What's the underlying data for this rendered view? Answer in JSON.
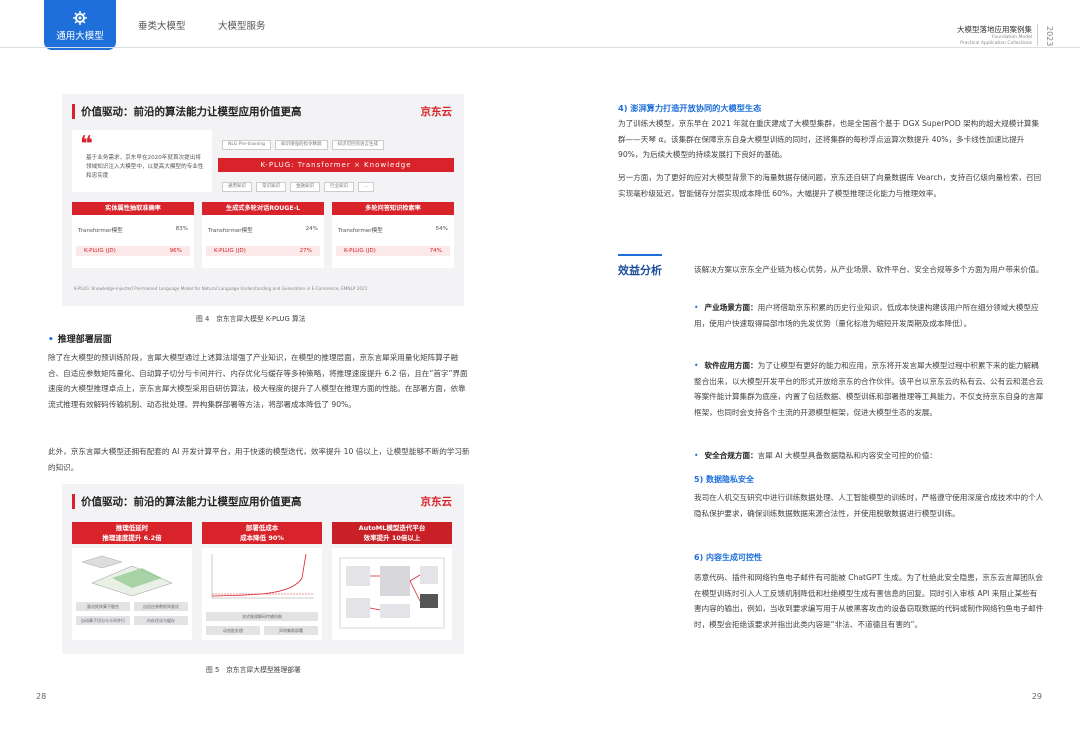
{
  "header": {
    "active_tab": "通用大模型",
    "nav": [
      "垂类大模型",
      "大模型服务"
    ],
    "doc_title": "大模型落地应用案例集",
    "doc_subtitle_1": "Foundation Model",
    "doc_subtitle_2": "Practical Application Collections",
    "year": "2023"
  },
  "figure1": {
    "title": "价值驱动：前沿的算法能力让模型应用价值更高",
    "logo": "京东云",
    "quote": "基于业务需求，京东早在2020年就首次提出将领域知识注入大模型中，以提高大模型的专业性和忠实度",
    "pills_top": [
      "NLG Pre-training",
      "知识增强的指令精调",
      "知识可控的语言生成"
    ],
    "kplug": "K-PLUG: Transformer × Knowledge",
    "pills_bottom": [
      "通用知识",
      "常识知识",
      "金融知识",
      "行业知识",
      "..."
    ],
    "metrics": [
      {
        "title": "实体属性抽取准确率",
        "rows": [
          [
            "Transformer模型",
            "83%"
          ],
          [
            "K-PLUG (JD)",
            "96%"
          ]
        ]
      },
      {
        "title": "生成式多轮对话ROUGE-L",
        "rows": [
          [
            "Transformer模型",
            "24%"
          ],
          [
            "K-PLUG (JD)",
            "27%"
          ]
        ]
      },
      {
        "title": "多轮问答知识检索率",
        "rows": [
          [
            "Transformer模型",
            "54%"
          ],
          [
            "K-PLUG (JD)",
            "74%"
          ]
        ]
      }
    ],
    "footnote": "K-PLUG: Knowledge-injected Pre-trained Language Model for Natural Language Understanding and Generation in E-Commerce, EMNLP 2021",
    "caption": "图 4　京东言犀大模型 K-PLUG 算法"
  },
  "left": {
    "bullet": "推理部署层面",
    "para1": "除了在大模型的预训练阶段，言犀大模型通过上述算法增强了产业知识，在模型的推理层面，京东言犀采用量化矩阵算子融合、自适应参数矩阵量化、自动算子切分与卡间并行、内存优化与缓存等多种策略，将推理速度提升 6.2 倍，且在“首字”界面速度的大模型推理卓点上，京东言犀大模型采用自研仿算法，极大程度的提升了人模型在推理方面的性能。在部署方面，依靠流式推理有效解码传输机制、动态批处理、异构集群部署等方法，将部署成本降低了 90%。",
    "para2": "此外，京东言犀大模型还拥有配套的 AI 开发计算平台，用于快速的模型迭代，效率提升 10 倍以上，让模型能够不断的学习新的知识。"
  },
  "figure2": {
    "title": "价值驱动：前沿的算法能力让模型应用价值更高",
    "logo": "京东云",
    "heads": [
      [
        "推理低延时",
        "推理速度提升 6.2倍"
      ],
      [
        "部署低成本",
        "成本降低 90%"
      ],
      [
        "AutoML模型迭代平台",
        "效率提升 10倍以上"
      ]
    ],
    "boxes": [
      "量化矩阵算子融合",
      "自适应参数矩阵量化",
      "自动算子切分与卡间并行",
      "内存优化与缓存",
      "流式推理解码传输机制",
      "动态批处理",
      "异构集群部署"
    ],
    "caption": "图 5　京东言犀大模型推理部署"
  },
  "right": {
    "sec4_title": "4) 澎湃算力打造开放协同的大模型生态",
    "sec4_p1": "为了训练大模型，京东早在 2021 年就在重庆建成了大模型集群，也是全国首个基于 DGX SuperPOD 架构的超大规模计算集群——天琴 α。该集群在保障京东自身大模型训练的同时，还将集群的每秒浮点运算次数提升 40%，多卡线性加速比提升 90%，为后续大模型的持续发展打下良好的基础。",
    "sec4_p2": "另一方面，为了更好的应对大模型背景下的海量数据存储问题，京东还自研了向量数据库 Vearch，支持百亿级向量检索，召回实现毫秒级延迟，智能储存分层实现成本降低 60%，大幅提升了模型推理泛化能力与推理效率。",
    "benefit_title": "效益分析",
    "benefit_intro": "该解决方案以京东全产业链为核心优势，从产业场景、软件平台、安全合规等多个方面为用户带来价值。",
    "b1_title": "产业场景方面：",
    "b1_text": "用户将借助京东积累的历史行业知识，低成本快速构建该用户所在细分领域大模型应用，使用户快速取得局部市场的先发优势（量化标准为缩短开发周期及成本降低）。",
    "b2_title": "软件应用方面：",
    "b2_text": "为了让模型有更好的能力和应用，京东将开发言犀大模型过程中积累下来的能力解耦整合出来，以大模型开发平台的形式开放给京东的合作伙伴。该平台以京东云的私有云、公有云和混合云等案件能计算集群为底座，内置了包括数据、模型训练和部署推理等工具能力，不仅支持京东自身的言犀框架，也同时会支持各个主流的开源模型框架，促进大模型生态的发展。",
    "b3_title": "安全合规方面：",
    "b3_text": "言犀 AI 大模型具备数据隐私和内容安全可控的价值：",
    "s5_title": "5) 数据隐私安全",
    "s5_text": "我司在人机交互研究中进行训练数据处理、人工智能模型的训练时，严格遵守使用深度合成技术中的个人隐私保护要求，确保训练数据数据来源合法性，并使用脱敏数据进行模型训练。",
    "s6_title": "6) 内容生成可控性",
    "s6_text": "恶意代码、插件和网络钓鱼电子邮件有可能被 ChatGPT 生成。为了杜绝此安全隐患，京东云言犀团队会在模型训练时引入人工反馈机制降低和杜绝模型生成有害信息的回复。同时引入审核 API 来阻止某些有害内容的输出，例如，当收到要求编写用于从被黑客攻击的设备窃取数据的代码或制作网络钓鱼电子邮件时，模型会拒绝该要求并指出此类内容是“非法、不道德且有害的”。"
  },
  "pages": {
    "left": "28",
    "right": "29"
  },
  "colors": {
    "accent_blue": "#1e6fd9",
    "jd_red": "#d8232a"
  }
}
